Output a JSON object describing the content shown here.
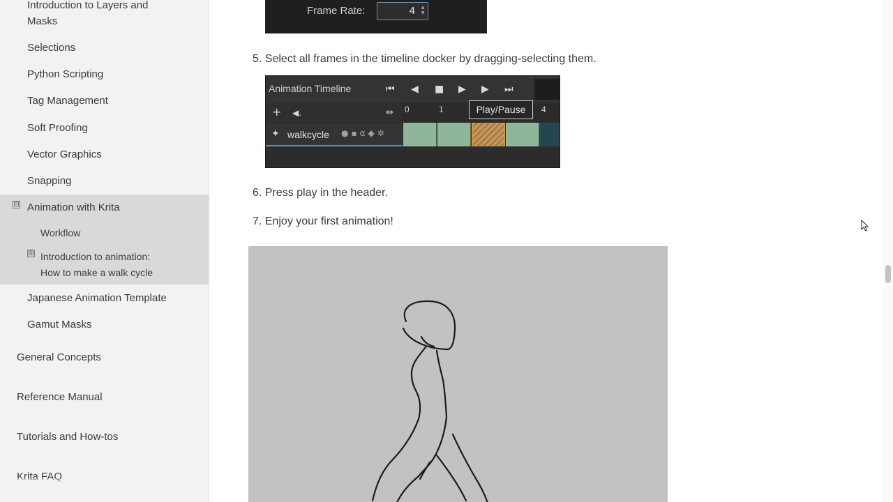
{
  "sidebar": {
    "items": [
      {
        "label": "Introduction to Layers and",
        "label2": "Masks"
      },
      {
        "label": "Selections"
      },
      {
        "label": "Python Scripting"
      },
      {
        "label": "Tag Management"
      },
      {
        "label": "Soft Proofing"
      },
      {
        "label": "Vector Graphics"
      },
      {
        "label": "Snapping"
      },
      {
        "label": "Animation with Krita",
        "toggle": "⊟"
      },
      {
        "label": "Workflow"
      },
      {
        "label": "Introduction to animation:",
        "label2": "How to make a walk cycle",
        "toggle": "⊞"
      },
      {
        "label": "Japanese Animation Template"
      },
      {
        "label": "Gamut Masks"
      },
      {
        "label": "General Concepts"
      },
      {
        "label": "Reference Manual"
      },
      {
        "label": "Tutorials and How-tos"
      },
      {
        "label": "Krita FAQ"
      }
    ]
  },
  "framerate": {
    "label": "Frame Rate:",
    "value": "4"
  },
  "steps": {
    "step5": "5. Select all frames in the timeline docker by dragging-selecting them.",
    "step6": "6. Press play in the header.",
    "step7": "7. Enjoy your first animation!"
  },
  "timeline": {
    "title": "Animation Timeline",
    "tooltip": "Play/Pause",
    "layer_name": "walkcycle",
    "frame_numbers": [
      "0",
      "1",
      "4"
    ],
    "controls": [
      "first-frame",
      "previous-frame",
      "stop",
      "play",
      "next-frame",
      "last-frame"
    ]
  },
  "colors": {
    "sidebar_bg": "#f2f2f2",
    "active_group_bg": "#d9d9d9",
    "frame_green": "#8fb59a",
    "frame_selected_border": "#e0932a",
    "layer_highlight": "#5a8fbf",
    "walk_bg": "#c2c2c2"
  }
}
